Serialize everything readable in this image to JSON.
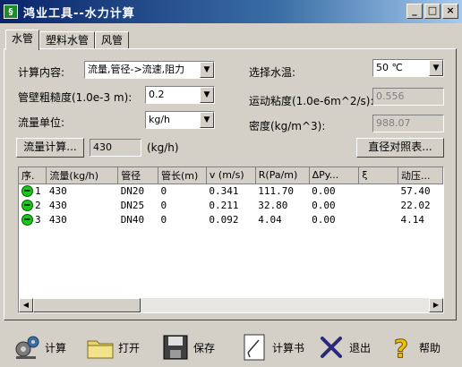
{
  "window": {
    "title": "鸿业工具--水力计算",
    "icon": "app-logo-icon"
  },
  "title_buttons": {
    "minimize": "_",
    "maximize": "□",
    "close": "×"
  },
  "tabs": [
    {
      "label": "水管",
      "active": true
    },
    {
      "label": "塑料水管",
      "active": false
    },
    {
      "label": "风管",
      "active": false
    }
  ],
  "form": {
    "calc_content_label": "计算内容:",
    "calc_content_value": "流量,管径->流速,阻力",
    "roughness_label": "管壁粗糙度(1.0e-3 m):",
    "roughness_value": "0.2",
    "flow_unit_label": "流量单位:",
    "flow_unit_value": "kg/h",
    "water_temp_label": "选择水温:",
    "water_temp_value": "50 ℃",
    "viscosity_label": "运动粘度(1.0e-6m^2/s):",
    "viscosity_value": "0.556",
    "density_label": "密度(kg/m^3):",
    "density_value": "988.07",
    "flow_calc_button": "流量计算...",
    "flow_value": "430",
    "flow_unit_text": "(kg/h)",
    "diameter_table_button": "直径对照表..."
  },
  "grid": {
    "columns": [
      "序.",
      "流量(kg/h)",
      "管径",
      "管长(m)",
      "v (m/s)",
      "R(Pa/m)",
      "ΔPy...",
      "ξ",
      "动压..."
    ],
    "rows": [
      [
        "1",
        "430",
        "DN20",
        "0",
        "0.341",
        "111.70",
        "0.00",
        "",
        "57.40"
      ],
      [
        "2",
        "430",
        "DN25",
        "0",
        "0.211",
        "32.80",
        "0.00",
        "",
        "22.02"
      ],
      [
        "3",
        "430",
        "DN40",
        "0",
        "0.092",
        "4.04",
        "0.00",
        "",
        "4.14"
      ]
    ],
    "status_color": "#18c818"
  },
  "toolbar": [
    {
      "label": "计算",
      "icon": "calculate-gears-icon"
    },
    {
      "label": "打开",
      "icon": "folder-icon"
    },
    {
      "label": "保存",
      "icon": "floppy-disk-icon"
    },
    {
      "label": "计算书",
      "icon": "report-document-icon"
    },
    {
      "label": "退出",
      "icon": "exit-x-icon"
    },
    {
      "label": "帮助",
      "icon": "help-question-icon"
    }
  ]
}
